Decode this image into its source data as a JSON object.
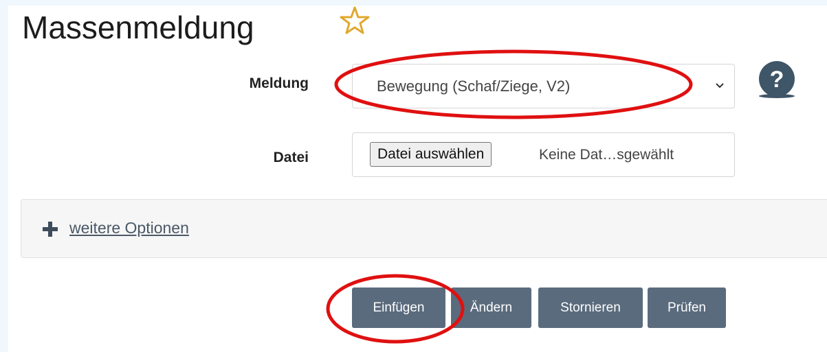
{
  "page": {
    "title": "Massenmeldung",
    "favorite_icon": "star-outline-icon"
  },
  "form": {
    "meldung_label": "Meldung",
    "meldung_selected": "Bewegung (Schaf/Ziege, V2)",
    "help_icon": "question-circle-icon",
    "datei_label": "Datei",
    "file_button_label": "Datei auswählen",
    "file_status": "Keine Dat…sgewählt"
  },
  "options": {
    "expand_icon": "plus-icon",
    "link_label": "weitere Optionen"
  },
  "actions": {
    "einfuegen": "Einfügen",
    "aendern": "Ändern",
    "stornieren": "Stornieren",
    "pruefen": "Prüfen"
  },
  "colors": {
    "button_bg": "#5a6b7d",
    "star": "#e0a82e",
    "annotation_red": "#e01010",
    "help_icon": "#3f5568"
  }
}
